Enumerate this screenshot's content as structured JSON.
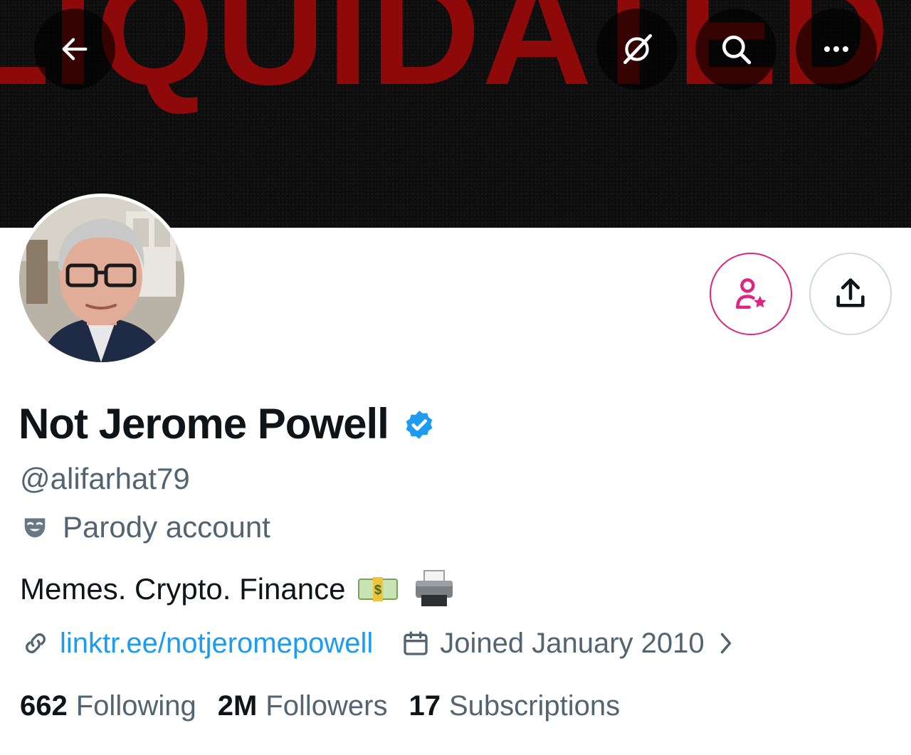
{
  "banner": {
    "text": "LIQUIDATED"
  },
  "topbar": {
    "back_icon": "arrow-left-icon",
    "grok_icon": "grok-icon",
    "search_icon": "search-icon",
    "more_icon": "more-horizontal-icon"
  },
  "actions": {
    "subscribe_icon": "person-star-icon",
    "share_icon": "share-upload-icon",
    "subscribe_color": "#e0237f"
  },
  "profile": {
    "name": "Not Jerome Powell",
    "verified_color": "#1d9bf0",
    "handle": "@alifarhat79",
    "parody_label": "Parody account",
    "bio": "Memes. Crypto. Finance",
    "website": "linktr.ee/notjeromepowell",
    "joined": "Joined January 2010"
  },
  "stats": {
    "following_count": "662",
    "following_label": "Following",
    "followers_count": "2M",
    "followers_label": "Followers",
    "subscriptions_count": "17",
    "subscriptions_label": "Subscriptions"
  }
}
